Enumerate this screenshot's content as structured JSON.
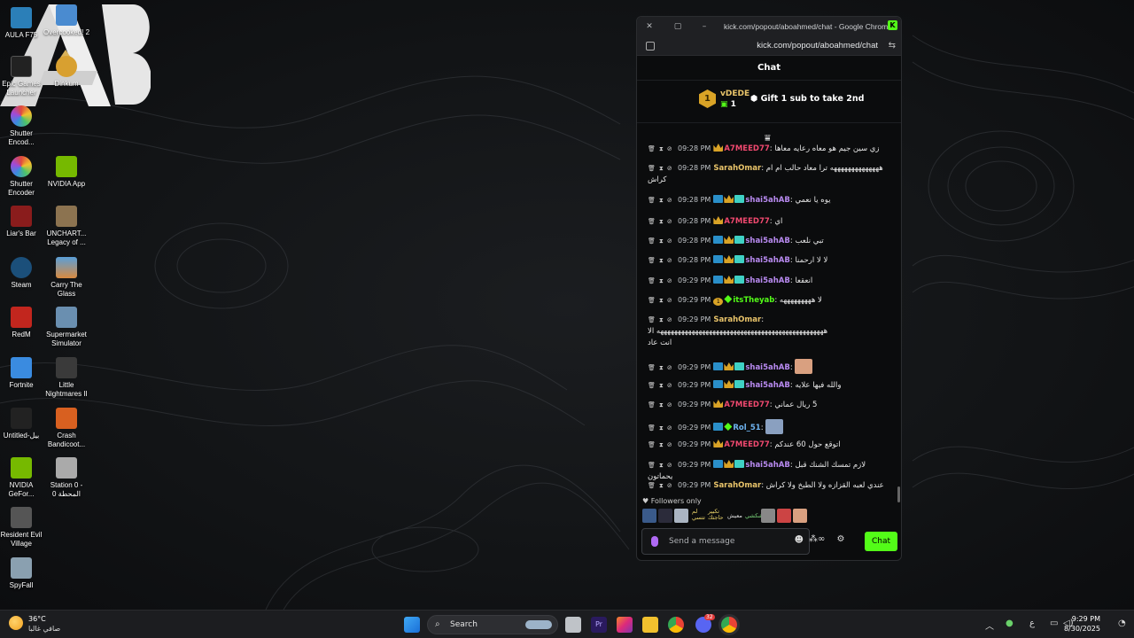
{
  "desktop": {
    "icons": [
      {
        "label": "AULA F75",
        "color": "#2b7fb8"
      },
      {
        "label": "Overcooked! 2",
        "color": "#4a8bd0"
      },
      {
        "label": "Epic Games Launcher",
        "color": "#222222"
      },
      {
        "label": "Dinkum",
        "color": "#d8a030"
      },
      {
        "label": "Shutter Encod...",
        "color": "#e0483e"
      },
      {
        "label": "Shutter Encoder",
        "color": "#e0483e"
      },
      {
        "label": "NVIDIA App",
        "color": "#76b900"
      },
      {
        "label": "Liar's Bar",
        "color": "#8a1c1c"
      },
      {
        "label": "UNCHART... Legacy of ...",
        "color": "#8c7350"
      },
      {
        "label": "Steam",
        "color": "#1b4f7a"
      },
      {
        "label": "Carry The Glass",
        "color": "#5a9fd8"
      },
      {
        "label": "RedM",
        "color": "#c2261e"
      },
      {
        "label": "Supermarket Simulator",
        "color": "#6a8fb0"
      },
      {
        "label": "Fortnite",
        "color": "#3a8be0"
      },
      {
        "label": "Little Nightmares II",
        "color": "#3a3a3a"
      },
      {
        "label": "Untitled-بيل",
        "color": "#222222"
      },
      {
        "label": "Crash Bandicoot...",
        "color": "#d86020"
      },
      {
        "label": "NVIDIA GeFor...",
        "color": "#76b900"
      },
      {
        "label": "Station 0 - المحطة 0",
        "color": "#aaaaaa"
      },
      {
        "label": "Resident Evil Village",
        "color": "#555555"
      },
      {
        "label": "SpyFall",
        "color": "#8aa0b0"
      }
    ]
  },
  "browser": {
    "window_title": "kick.com/popout/aboahmed/chat - Google Chrome",
    "url": "kick.com/popout/aboahmed/chat"
  },
  "chat": {
    "header": "Chat",
    "gift": {
      "rank": "1",
      "username": "vDEDE",
      "count": "1",
      "cta": "Gift 1 sub to take 2nd"
    },
    "messages": [
      {
        "time": "09:28 PM",
        "user": "A7MEED77",
        "user_color": "#f0496f",
        "text": "زي سين جيم هو معاه رعايه معاها",
        "badges": [
          "crown"
        ]
      },
      {
        "time": "09:28 PM",
        "user": "SarahOmar",
        "user_color": "#e9c46a",
        "text": "ههههههههههههههه ترا معاد حالب ام ام",
        "text2": "كراش",
        "badges": []
      },
      {
        "time": "09:28 PM",
        "user": "shai5ahAB",
        "user_color": "#b88af0",
        "text": "يوه يا نعمي",
        "badges": [
          "sub",
          "crown",
          "tier"
        ]
      },
      {
        "time": "09:28 PM",
        "user": "A7MEED77",
        "user_color": "#f0496f",
        "text": "اي",
        "badges": [
          "crown"
        ]
      },
      {
        "time": "09:28 PM",
        "user": "shai5ahAB",
        "user_color": "#b88af0",
        "text": "تبي نلعب",
        "badges": [
          "sub",
          "crown",
          "tier"
        ]
      },
      {
        "time": "09:28 PM",
        "user": "shai5ahAB",
        "user_color": "#b88af0",
        "text": "لا لا ارحمنا",
        "badges": [
          "sub",
          "crown",
          "tier"
        ]
      },
      {
        "time": "09:29 PM",
        "user": "shai5ahAB",
        "user_color": "#b88af0",
        "text": "انعقعا",
        "badges": [
          "sub",
          "crown",
          "tier"
        ]
      },
      {
        "time": "09:29 PM",
        "user": "itsTheyab",
        "user_color": "#53fc18",
        "text": "لا هههههههههه",
        "badges": [
          "one",
          "og"
        ]
      },
      {
        "time": "09:29 PM",
        "user": "SarahOmar",
        "user_color": "#e9c46a",
        "text": "ههههههههههههههههههههههههههههههههههههههههههههههههه الا",
        "text2": "انت عاد",
        "badges": []
      },
      {
        "time": "09:29 PM",
        "user": "shai5ahAB",
        "user_color": "#b88af0",
        "text": "",
        "emote": true,
        "badges": [
          "sub",
          "crown",
          "tier"
        ]
      },
      {
        "time": "09:29 PM",
        "user": "shai5ahAB",
        "user_color": "#b88af0",
        "text": "والله فيها علايه",
        "badges": [
          "sub",
          "crown",
          "tier"
        ]
      },
      {
        "time": "09:29 PM",
        "user": "A7MEED77",
        "user_color": "#f0496f",
        "text": "5 ريال عماني",
        "badges": [
          "crown"
        ]
      },
      {
        "time": "09:29 PM",
        "user": "Rol_51",
        "user_color": "#6fb4f0",
        "text": "",
        "emote": true,
        "badges": [
          "sub",
          "og"
        ]
      },
      {
        "time": "09:29 PM",
        "user": "A7MEED77",
        "user_color": "#f0496f",
        "text": "اتوقع حول 60 عندكم",
        "badges": [
          "crown"
        ]
      },
      {
        "time": "09:29 PM",
        "user": "shai5ahAB",
        "user_color": "#b88af0",
        "text": "لازم تمسك الشنك قبل يحماتون",
        "badges": [
          "sub",
          "crown",
          "tier"
        ]
      },
      {
        "time": "09:29 PM",
        "user": "SarahOmar",
        "user_color": "#e9c46a",
        "text": "عندي لعبه القزازه ولا الطبخ ولا كراش",
        "badges": []
      }
    ],
    "followers_only_label": "Followers only",
    "emote_strip_labels": [
      "لم تتسي",
      "تكبير حاجتك",
      "معيش",
      "شكشي"
    ],
    "composer": {
      "placeholder": "Send a message",
      "send_label": "Chat"
    }
  },
  "taskbar": {
    "weather_temp": "36°C",
    "weather_desc": "صافي غالبا",
    "search_label": "Search",
    "lang": "ع",
    "time": "9:29 PM",
    "date": "8/30/2025",
    "discord_badge": "32"
  }
}
